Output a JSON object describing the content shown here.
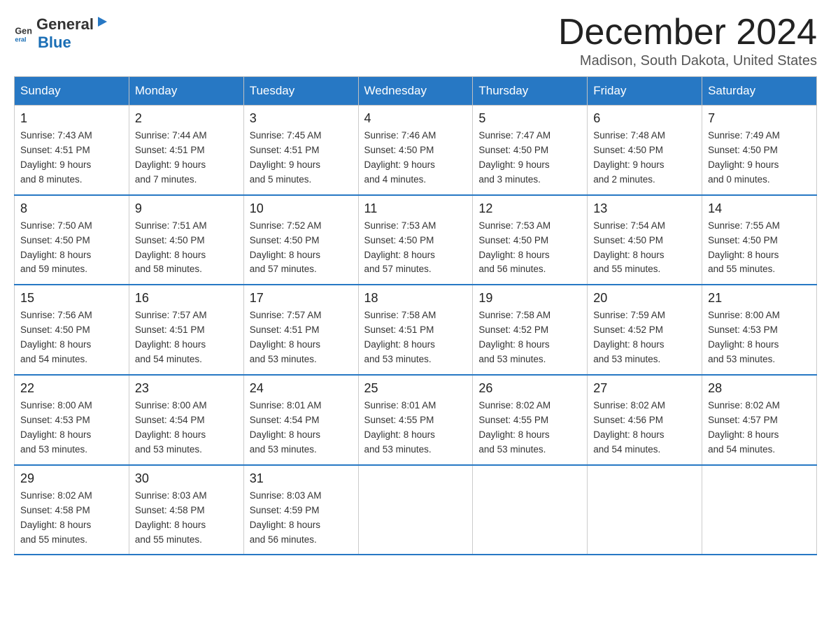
{
  "header": {
    "logo_general": "General",
    "logo_blue": "Blue",
    "month_title": "December 2024",
    "location": "Madison, South Dakota, United States"
  },
  "weekdays": [
    "Sunday",
    "Monday",
    "Tuesday",
    "Wednesday",
    "Thursday",
    "Friday",
    "Saturday"
  ],
  "weeks": [
    [
      {
        "day": "1",
        "info": "Sunrise: 7:43 AM\nSunset: 4:51 PM\nDaylight: 9 hours\nand 8 minutes."
      },
      {
        "day": "2",
        "info": "Sunrise: 7:44 AM\nSunset: 4:51 PM\nDaylight: 9 hours\nand 7 minutes."
      },
      {
        "day": "3",
        "info": "Sunrise: 7:45 AM\nSunset: 4:51 PM\nDaylight: 9 hours\nand 5 minutes."
      },
      {
        "day": "4",
        "info": "Sunrise: 7:46 AM\nSunset: 4:50 PM\nDaylight: 9 hours\nand 4 minutes."
      },
      {
        "day": "5",
        "info": "Sunrise: 7:47 AM\nSunset: 4:50 PM\nDaylight: 9 hours\nand 3 minutes."
      },
      {
        "day": "6",
        "info": "Sunrise: 7:48 AM\nSunset: 4:50 PM\nDaylight: 9 hours\nand 2 minutes."
      },
      {
        "day": "7",
        "info": "Sunrise: 7:49 AM\nSunset: 4:50 PM\nDaylight: 9 hours\nand 0 minutes."
      }
    ],
    [
      {
        "day": "8",
        "info": "Sunrise: 7:50 AM\nSunset: 4:50 PM\nDaylight: 8 hours\nand 59 minutes."
      },
      {
        "day": "9",
        "info": "Sunrise: 7:51 AM\nSunset: 4:50 PM\nDaylight: 8 hours\nand 58 minutes."
      },
      {
        "day": "10",
        "info": "Sunrise: 7:52 AM\nSunset: 4:50 PM\nDaylight: 8 hours\nand 57 minutes."
      },
      {
        "day": "11",
        "info": "Sunrise: 7:53 AM\nSunset: 4:50 PM\nDaylight: 8 hours\nand 57 minutes."
      },
      {
        "day": "12",
        "info": "Sunrise: 7:53 AM\nSunset: 4:50 PM\nDaylight: 8 hours\nand 56 minutes."
      },
      {
        "day": "13",
        "info": "Sunrise: 7:54 AM\nSunset: 4:50 PM\nDaylight: 8 hours\nand 55 minutes."
      },
      {
        "day": "14",
        "info": "Sunrise: 7:55 AM\nSunset: 4:50 PM\nDaylight: 8 hours\nand 55 minutes."
      }
    ],
    [
      {
        "day": "15",
        "info": "Sunrise: 7:56 AM\nSunset: 4:50 PM\nDaylight: 8 hours\nand 54 minutes."
      },
      {
        "day": "16",
        "info": "Sunrise: 7:57 AM\nSunset: 4:51 PM\nDaylight: 8 hours\nand 54 minutes."
      },
      {
        "day": "17",
        "info": "Sunrise: 7:57 AM\nSunset: 4:51 PM\nDaylight: 8 hours\nand 53 minutes."
      },
      {
        "day": "18",
        "info": "Sunrise: 7:58 AM\nSunset: 4:51 PM\nDaylight: 8 hours\nand 53 minutes."
      },
      {
        "day": "19",
        "info": "Sunrise: 7:58 AM\nSunset: 4:52 PM\nDaylight: 8 hours\nand 53 minutes."
      },
      {
        "day": "20",
        "info": "Sunrise: 7:59 AM\nSunset: 4:52 PM\nDaylight: 8 hours\nand 53 minutes."
      },
      {
        "day": "21",
        "info": "Sunrise: 8:00 AM\nSunset: 4:53 PM\nDaylight: 8 hours\nand 53 minutes."
      }
    ],
    [
      {
        "day": "22",
        "info": "Sunrise: 8:00 AM\nSunset: 4:53 PM\nDaylight: 8 hours\nand 53 minutes."
      },
      {
        "day": "23",
        "info": "Sunrise: 8:00 AM\nSunset: 4:54 PM\nDaylight: 8 hours\nand 53 minutes."
      },
      {
        "day": "24",
        "info": "Sunrise: 8:01 AM\nSunset: 4:54 PM\nDaylight: 8 hours\nand 53 minutes."
      },
      {
        "day": "25",
        "info": "Sunrise: 8:01 AM\nSunset: 4:55 PM\nDaylight: 8 hours\nand 53 minutes."
      },
      {
        "day": "26",
        "info": "Sunrise: 8:02 AM\nSunset: 4:55 PM\nDaylight: 8 hours\nand 53 minutes."
      },
      {
        "day": "27",
        "info": "Sunrise: 8:02 AM\nSunset: 4:56 PM\nDaylight: 8 hours\nand 54 minutes."
      },
      {
        "day": "28",
        "info": "Sunrise: 8:02 AM\nSunset: 4:57 PM\nDaylight: 8 hours\nand 54 minutes."
      }
    ],
    [
      {
        "day": "29",
        "info": "Sunrise: 8:02 AM\nSunset: 4:58 PM\nDaylight: 8 hours\nand 55 minutes."
      },
      {
        "day": "30",
        "info": "Sunrise: 8:03 AM\nSunset: 4:58 PM\nDaylight: 8 hours\nand 55 minutes."
      },
      {
        "day": "31",
        "info": "Sunrise: 8:03 AM\nSunset: 4:59 PM\nDaylight: 8 hours\nand 56 minutes."
      },
      {
        "day": "",
        "info": ""
      },
      {
        "day": "",
        "info": ""
      },
      {
        "day": "",
        "info": ""
      },
      {
        "day": "",
        "info": ""
      }
    ]
  ]
}
